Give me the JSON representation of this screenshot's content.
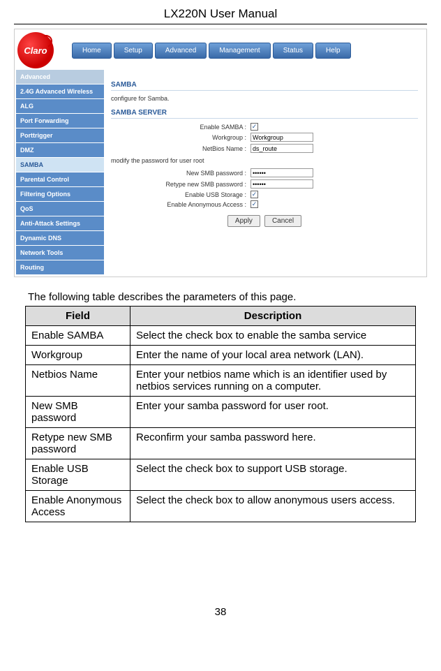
{
  "page_title": "LX220N User Manual",
  "page_number": "38",
  "logo_text": "Claro",
  "nav": [
    "Home",
    "Setup",
    "Advanced",
    "Management",
    "Status",
    "Help"
  ],
  "sidebar": {
    "header": "Advanced",
    "items": [
      "2.4G Advanced Wireless",
      "ALG",
      "Port Forwarding",
      "Porttrigger",
      "DMZ",
      "SAMBA",
      "Parental Control",
      "Filtering Options",
      "QoS",
      "Anti-Attack Settings",
      "Dynamic DNS",
      "Network Tools",
      "Routing"
    ],
    "active_index": 5
  },
  "content": {
    "section1": "SAMBA",
    "desc": "configure for Samba.",
    "section2": "SAMBA SERVER",
    "fields": {
      "enable_samba_label": "Enable SAMBA :",
      "workgroup_label": "Workgroup :",
      "workgroup_value": "Workgroup",
      "netbios_label": "NetBios Name :",
      "netbios_value": "ds_route",
      "modify_note": "modify the password for user root",
      "newpw_label": "New SMB password :",
      "newpw_value": "••••••",
      "retypepw_label": "Retype new SMB password :",
      "retypepw_value": "••••••",
      "enable_usb_label": "Enable USB Storage :",
      "enable_anon_label": "Enable Anonymous Access :"
    },
    "btn_apply": "Apply",
    "btn_cancel": "Cancel"
  },
  "intro": "The following table describes the parameters of this page.",
  "table": {
    "head_field": "Field",
    "head_desc": "Description",
    "rows": [
      {
        "f": "Enable SAMBA",
        "d": "Select the check box to enable the samba service"
      },
      {
        "f": "Workgroup",
        "d": "Enter the name of your local area network (LAN)."
      },
      {
        "f": "Netbios Name",
        "d": "Enter your netbios name which is an identifier used by netbios services running on a computer."
      },
      {
        "f": "New SMB password",
        "d": "Enter your samba password for user root."
      },
      {
        "f": "Retype new SMB password",
        "d": "Reconfirm your samba password here."
      },
      {
        "f": "Enable USB Storage",
        "d": "Select the check box to support USB storage."
      },
      {
        "f": "Enable Anonymous Access",
        "d": "Select the check box to allow anonymous users access."
      }
    ]
  }
}
